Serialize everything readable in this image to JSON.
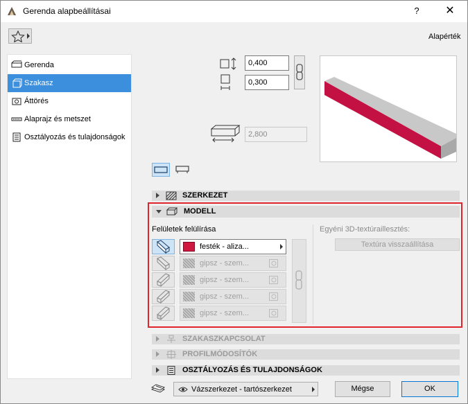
{
  "window": {
    "title": "Gerenda alapbeállításai",
    "help": "?",
    "close": "✕"
  },
  "header": {
    "default_label": "Alapérték"
  },
  "sidebar": {
    "items": [
      {
        "label": "Gerenda",
        "icon": "beam-icon"
      },
      {
        "label": "Szakasz",
        "icon": "segment-icon",
        "selected": true
      },
      {
        "label": "Áttörés",
        "icon": "hole-icon"
      },
      {
        "label": "Alaprajz és metszet",
        "icon": "floorplan-icon"
      },
      {
        "label": "Osztályozás és tulajdonságok",
        "icon": "classification-icon"
      }
    ]
  },
  "geometry": {
    "height_value": "0,400",
    "width_value": "0,300",
    "length_value": "2,800"
  },
  "sections": {
    "szerkezet": "SZERKEZET",
    "modell": "MODELL",
    "szakaszkapcsolat": "SZAKASZKAPCSOLAT",
    "profilmodositok": "PROFILMÓDOSÍTÓK",
    "osztalyozas": "OSZTÁLYOZÁS ÉS TULAJDONSÁGOK"
  },
  "modell": {
    "override_label": "Felületek felülírása",
    "texture_label": "Egyéni 3D-textúraillesztés:",
    "texture_reset": "Textúra visszaállítása",
    "surfaces": [
      {
        "name": "festék - aliza...",
        "active": true,
        "color": "#d0173f"
      },
      {
        "name": "gipsz - szem...",
        "active": false
      },
      {
        "name": "gipsz - szem...",
        "active": false
      },
      {
        "name": "gipsz - szem...",
        "active": false
      },
      {
        "name": "gipsz - szem...",
        "active": false
      }
    ]
  },
  "footer": {
    "layer_value": "Vázszerkezet - tartószerkezet",
    "cancel": "Mégse",
    "ok": "OK"
  },
  "colors": {
    "accent": "#3c8fdc",
    "beam_front": "#c41143",
    "beam_side": "#a9a9a9",
    "highlight": "#e0242b"
  }
}
